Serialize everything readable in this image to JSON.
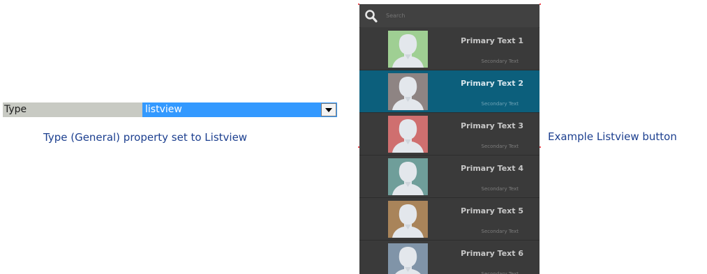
{
  "property": {
    "name": "Type",
    "value": "listview",
    "caption": "Type (General) property set to Listview"
  },
  "listview_widget": {
    "search_placeholder": "Search",
    "caption": "Example Listview button",
    "items": [
      {
        "primary": "Primary Text 1",
        "secondary": "Secondary Text",
        "avatar_color": "#9fcf93",
        "selected": false
      },
      {
        "primary": "Primary Text 2",
        "secondary": "Secondary Text",
        "avatar_color": "#8e8483",
        "selected": true
      },
      {
        "primary": "Primary Text 3",
        "secondary": "Secondary Text",
        "avatar_color": "#cf6f6f",
        "selected": false
      },
      {
        "primary": "Primary Text 4",
        "secondary": "Secondary Text",
        "avatar_color": "#6f9e9a",
        "selected": false
      },
      {
        "primary": "Primary Text 5",
        "secondary": "Secondary Text",
        "avatar_color": "#a9845a",
        "selected": false
      },
      {
        "primary": "Primary Text 6",
        "secondary": "Secondary Text",
        "avatar_color": "#8094a8",
        "selected": false
      }
    ]
  },
  "colors": {
    "selection": "#3399ff",
    "listview_bg": "#3a3a3a",
    "selected_row": "#0c5f7c",
    "caption_text": "#1c3f8f"
  },
  "icons": {
    "search": "search-icon",
    "dropdown": "chevron-down-icon",
    "avatar": "person-silhouette-icon"
  }
}
